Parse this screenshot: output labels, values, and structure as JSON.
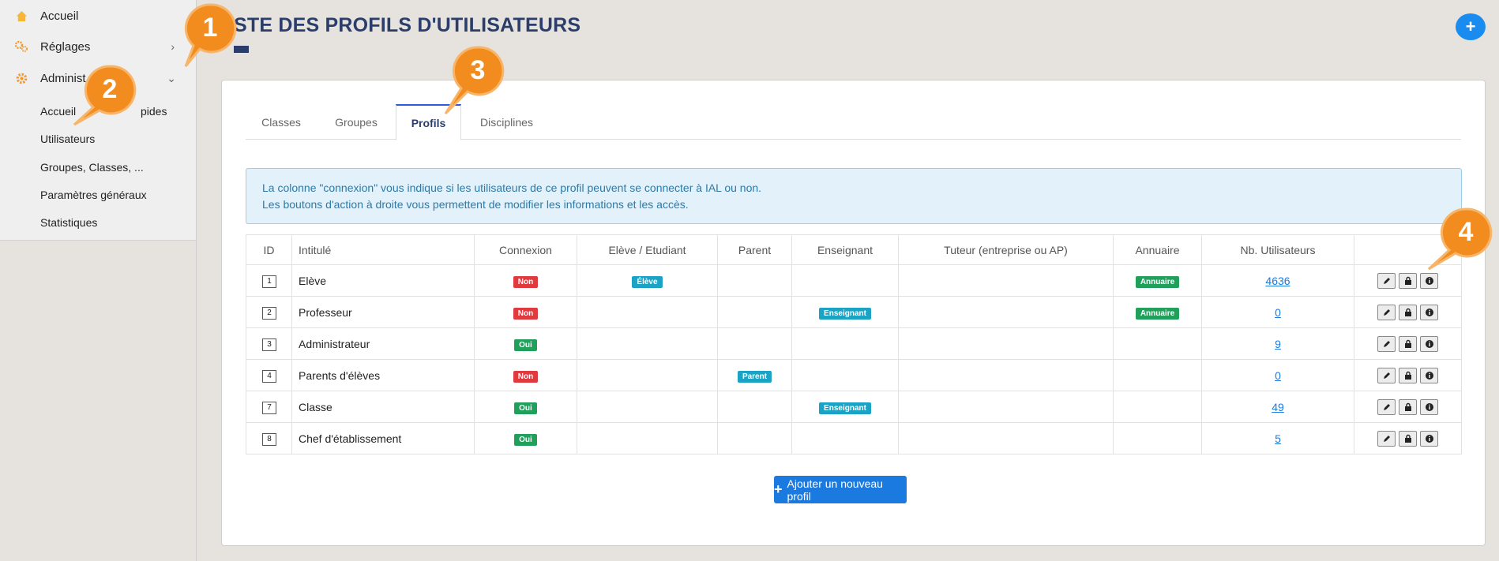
{
  "sidebar": {
    "items": [
      {
        "label": "Accueil",
        "icon": "home-icon"
      },
      {
        "label": "Réglages",
        "icon": "cogs-icon"
      },
      {
        "label": "Administ",
        "icon": "gear-icon"
      }
    ],
    "sub_items": [
      {
        "label": "Accueil"
      },
      {
        "label": "pides"
      },
      {
        "label": "Utilisateurs"
      },
      {
        "label": "Groupes, Classes, ..."
      },
      {
        "label": "Paramètres généraux"
      },
      {
        "label": "Statistiques"
      }
    ]
  },
  "header": {
    "title": "STE DES PROFILS D'UTILISATEURS",
    "add_button": "+"
  },
  "tabs": [
    {
      "label": "Classes",
      "active": false
    },
    {
      "label": "Groupes",
      "active": false
    },
    {
      "label": "Profils",
      "active": true
    },
    {
      "label": "Disciplines",
      "active": false
    }
  ],
  "info": {
    "line1": "La colonne \"connexion\" vous indique si les utilisateurs de ce profil peuvent se connecter à IAL ou non.",
    "line2": "Les boutons d'action à droite vous permettent de modifier les informations et les accès."
  },
  "table": {
    "headers": [
      "ID",
      "Intitulé",
      "Connexion",
      "Elève / Etudiant",
      "Parent",
      "Enseignant",
      "Tuteur (entreprise ou AP)",
      "Annuaire",
      "Nb. Utilisateurs",
      ""
    ],
    "rows": [
      {
        "id": "1",
        "name": "Elève",
        "connexion": "Non",
        "eleve": "Élève",
        "parent": "",
        "enseignant": "",
        "tuteur": "",
        "annuaire": "Annuaire",
        "nb": "4636"
      },
      {
        "id": "2",
        "name": "Professeur",
        "connexion": "Non",
        "eleve": "",
        "parent": "",
        "enseignant": "Enseignant",
        "tuteur": "",
        "annuaire": "Annuaire",
        "nb": "0"
      },
      {
        "id": "3",
        "name": "Administrateur",
        "connexion": "Oui",
        "eleve": "",
        "parent": "",
        "enseignant": "",
        "tuteur": "",
        "annuaire": "",
        "nb": "9"
      },
      {
        "id": "4",
        "name": "Parents d'élèves",
        "connexion": "Non",
        "eleve": "",
        "parent": "Parent",
        "enseignant": "",
        "tuteur": "",
        "annuaire": "",
        "nb": "0"
      },
      {
        "id": "7",
        "name": "Classe",
        "connexion": "Oui",
        "eleve": "",
        "parent": "",
        "enseignant": "Enseignant",
        "tuteur": "",
        "annuaire": "",
        "nb": "49"
      },
      {
        "id": "8",
        "name": "Chef d'établissement",
        "connexion": "Oui",
        "eleve": "",
        "parent": "",
        "enseignant": "",
        "tuteur": "",
        "annuaire": "",
        "nb": "5"
      }
    ]
  },
  "add_profile_button": "Ajouter un nouveau profil",
  "callouts": [
    "1",
    "2",
    "3",
    "4"
  ],
  "colors": {
    "accent": "#1a7ae0",
    "title": "#2b3d6b",
    "callout": "#f28c1e",
    "no": "#e0393e",
    "yes": "#21a05b",
    "tag": "#1aa3c4"
  }
}
